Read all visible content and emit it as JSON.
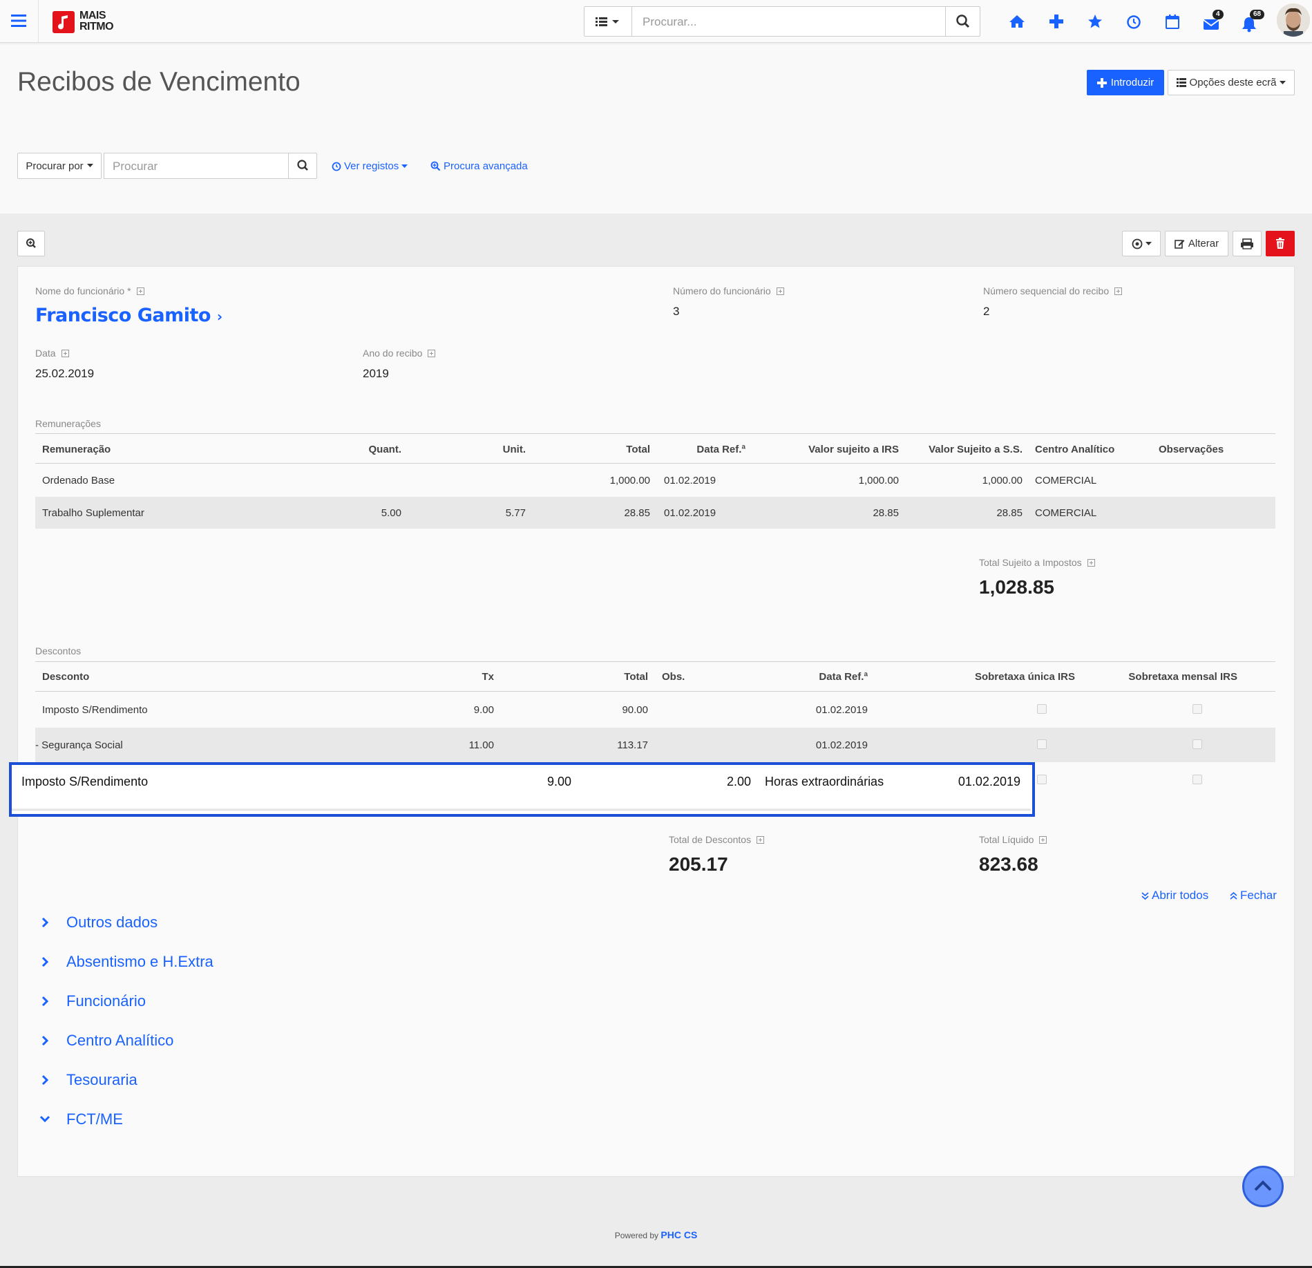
{
  "topbar": {
    "logo_line1": "MAIS",
    "logo_line2": "RITMO",
    "search_placeholder": "Procurar...",
    "mail_count": "4",
    "notification_count": "68"
  },
  "header": {
    "title": "Recibos de Vencimento",
    "introduce_label": "Introduzir",
    "options_label": "Opções deste ecrã"
  },
  "search_row": {
    "search_by_label": "Procurar por",
    "search_placeholder": "Procurar",
    "view_records_label": "Ver registos",
    "advanced_search_label": "Procura avançada"
  },
  "toolbar": {
    "edit_label": "Alterar"
  },
  "record": {
    "employee_name_label": "Nome do funcionário *",
    "employee_name": "Francisco Gamito",
    "employee_number_label": "Número do funcionário",
    "employee_number": "3",
    "receipt_seq_label": "Número sequencial do recibo",
    "receipt_seq": "2",
    "date_label": "Data",
    "date": "25.02.2019",
    "year_label": "Ano do recibo",
    "year": "2019"
  },
  "remuneracoes": {
    "section_label": "Remunerações",
    "headers": [
      "Remuneração",
      "Quant.",
      "Unit.",
      "Total",
      "Data Ref.ª",
      "Valor sujeito a IRS",
      "Valor Sujeito a S.S.",
      "Centro Analítico",
      "Observações"
    ],
    "rows": [
      [
        "Ordenado Base",
        "",
        "",
        "1,000.00",
        "01.02.2019",
        "1,000.00",
        "1,000.00",
        "COMERCIAL",
        ""
      ],
      [
        "Trabalho Suplementar",
        "5.00",
        "5.77",
        "28.85",
        "01.02.2019",
        "28.85",
        "28.85",
        "COMERCIAL",
        ""
      ]
    ],
    "total_taxable_label": "Total Sujeito a Impostos",
    "total_taxable": "1,028.85"
  },
  "descontos": {
    "section_label": "Descontos",
    "headers": [
      "Desconto",
      "Tx",
      "Total",
      "Obs.",
      "Data Ref.ª",
      "Sobretaxa única IRS",
      "Sobretaxa mensal IRS"
    ],
    "rows": [
      [
        "Imposto S/Rendimento",
        "9.00",
        "90.00",
        "",
        "01.02.2019"
      ],
      [
        "- Segurança Social",
        "11.00",
        "113.17",
        "",
        "01.02.2019"
      ]
    ],
    "editing_row": [
      "Imposto S/Rendimento",
      "9.00",
      "2.00",
      "Horas extraordinárias",
      "01.02.2019"
    ],
    "total_discounts_label": "Total de Descontos",
    "total_discounts": "205.17",
    "total_net_label": "Total Líquido",
    "total_net": "823.68"
  },
  "accordion": {
    "open_all_label": "Abrir todos",
    "close_label": "Fechar",
    "items": [
      "Outros dados",
      "Absentismo e H.Extra",
      "Funcionário",
      "Centro Analítico",
      "Tesouraria",
      "FCT/ME"
    ]
  },
  "footer": {
    "powered_by": "Powered by",
    "brand": "PHC CS"
  },
  "colors": {
    "accent": "#1a62ff",
    "danger": "#e3121b",
    "highlight_border": "#1a4fd6"
  }
}
